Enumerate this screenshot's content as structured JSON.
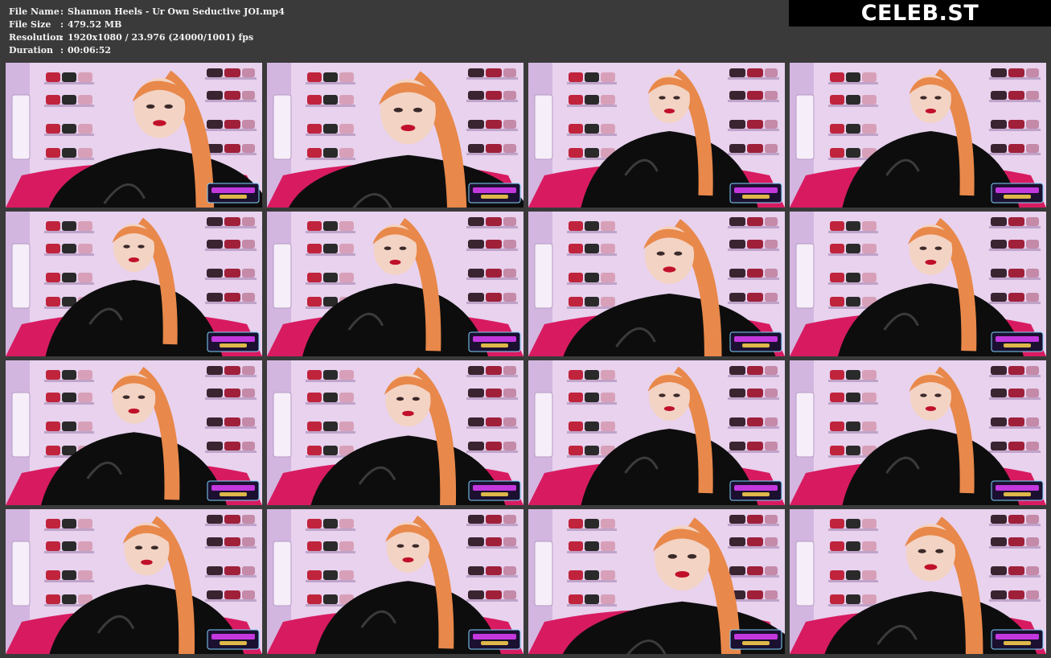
{
  "file_info": [
    {
      "key": "File Name",
      "value": "Shannon Heels - Ur Own Seductive JOI.mp4"
    },
    {
      "key": "File Size",
      "value": "479.52 MB"
    },
    {
      "key": "Resolution",
      "value": "1920x1080 / 23.976 (24000/1001) fps"
    },
    {
      "key": "Duration",
      "value": "00:06:52"
    }
  ],
  "separator": ":",
  "logo_text": "CELEB.ST",
  "thumbnails": [
    {
      "name": "frame-01"
    },
    {
      "name": "frame-02"
    },
    {
      "name": "frame-03"
    },
    {
      "name": "frame-04"
    },
    {
      "name": "frame-05"
    },
    {
      "name": "frame-06"
    },
    {
      "name": "frame-07"
    },
    {
      "name": "frame-08"
    },
    {
      "name": "frame-09"
    },
    {
      "name": "frame-10"
    },
    {
      "name": "frame-11"
    },
    {
      "name": "frame-12"
    },
    {
      "name": "frame-13"
    },
    {
      "name": "frame-14"
    },
    {
      "name": "frame-15"
    },
    {
      "name": "frame-16"
    }
  ],
  "colors": {
    "background": "#3a3a3a",
    "text": "#f2f2f2",
    "logo_bg": "#000000",
    "wall": "#e8d2ee",
    "chair": "#d81b60",
    "suit": "#0d0d0d",
    "hair": "#e8884a"
  }
}
